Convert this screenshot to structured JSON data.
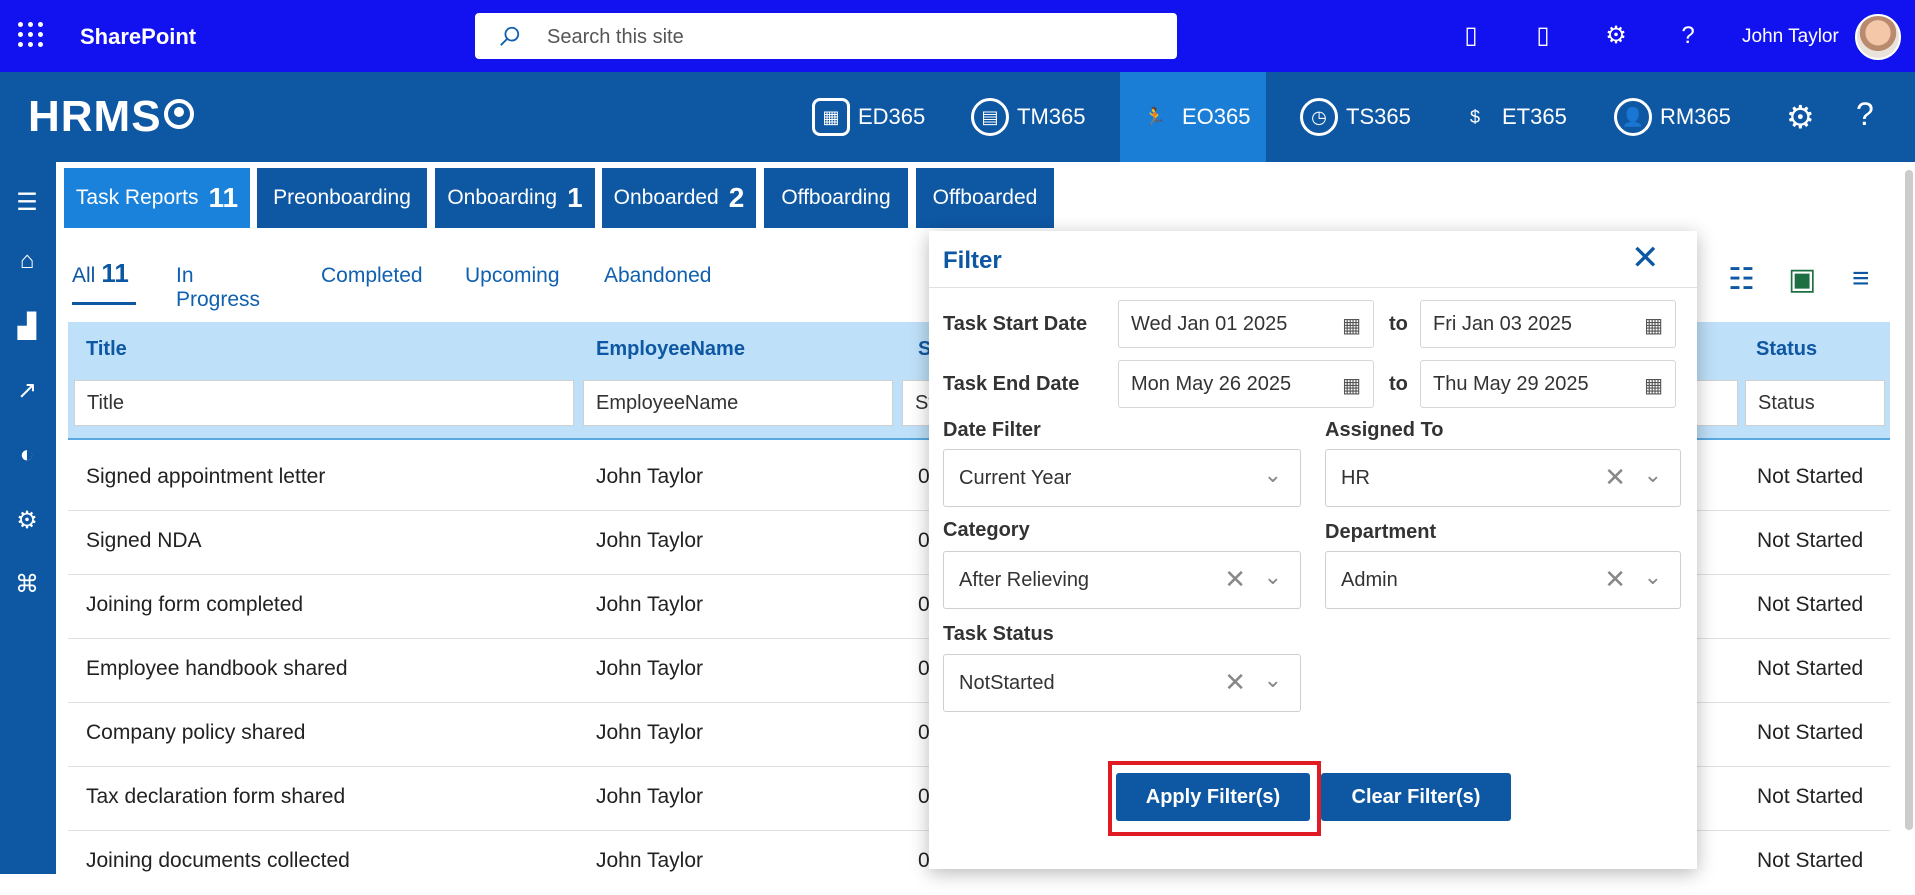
{
  "topbar": {
    "app_name": "SharePoint",
    "search_placeholder": "Search this site",
    "user_name": "John Taylor",
    "help_glyph": "?"
  },
  "appbar": {
    "logo": "HRMS",
    "apps": [
      {
        "label": "ED365",
        "icon": "team-icon"
      },
      {
        "label": "TM365",
        "icon": "calendar-icon"
      },
      {
        "label": "EO365",
        "icon": "onboarding-icon"
      },
      {
        "label": "TS365",
        "icon": "clock-icon"
      },
      {
        "label": "ET365",
        "icon": "expense-icon"
      },
      {
        "label": "RM365",
        "icon": "person-icon"
      }
    ],
    "active_app": "EO365",
    "help_glyph": "?"
  },
  "tabs": [
    {
      "label": "Task Reports",
      "count": "11"
    },
    {
      "label": "Preonboarding",
      "count": ""
    },
    {
      "label": "Onboarding",
      "count": "1"
    },
    {
      "label": "Onboarded",
      "count": "2"
    },
    {
      "label": "Offboarding",
      "count": ""
    },
    {
      "label": "Offboarded",
      "count": ""
    }
  ],
  "subtabs": [
    {
      "label": "All",
      "count": "11"
    },
    {
      "label": "In Progress",
      "count": ""
    },
    {
      "label": "Completed",
      "count": ""
    },
    {
      "label": "Upcoming",
      "count": ""
    },
    {
      "label": "Abandoned",
      "count": ""
    }
  ],
  "grid": {
    "columns": [
      "Title",
      "EmployeeName",
      "S",
      "Status"
    ],
    "filters": [
      "Title",
      "EmployeeName",
      "St",
      "Status"
    ],
    "rows": [
      {
        "title": "Signed appointment letter",
        "employee": "John Taylor",
        "s": "0",
        "status": "Not Started"
      },
      {
        "title": "Signed NDA",
        "employee": "John Taylor",
        "s": "0",
        "status": "Not Started"
      },
      {
        "title": "Joining form completed",
        "employee": "John Taylor",
        "s": "0",
        "status": "Not Started"
      },
      {
        "title": "Employee handbook shared",
        "employee": "John Taylor",
        "s": "0",
        "status": "Not Started"
      },
      {
        "title": "Company policy shared",
        "employee": "John Taylor",
        "s": "0",
        "status": "Not Started"
      },
      {
        "title": "Tax declaration form shared",
        "employee": "John Taylor",
        "s": "0",
        "status": "Not Started"
      },
      {
        "title": "Joining documents collected",
        "employee": "John Taylor",
        "s": "0",
        "status": "Not Started"
      }
    ]
  },
  "filter_panel": {
    "title": "Filter",
    "task_start_label": "Task Start Date",
    "task_start_from": "Wed Jan 01 2025",
    "task_start_to": "Fri Jan 03 2025",
    "task_end_label": "Task End Date",
    "task_end_from": "Mon May 26 2025",
    "task_end_to": "Thu May 29 2025",
    "to_label": "to",
    "date_filter_label": "Date Filter",
    "date_filter_value": "Current Year",
    "assigned_to_label": "Assigned To",
    "assigned_to_value": "HR",
    "category_label": "Category",
    "category_value": "After Relieving",
    "department_label": "Department",
    "department_value": "Admin",
    "task_status_label": "Task Status",
    "task_status_value": "NotStarted",
    "apply_label": "Apply Filter(s)",
    "clear_label": "Clear Filter(s)"
  },
  "colors": {
    "topbar": "#1212f0",
    "appbar": "#0e57a3",
    "accent": "#1b82dc",
    "highlight": "#e01b24"
  }
}
